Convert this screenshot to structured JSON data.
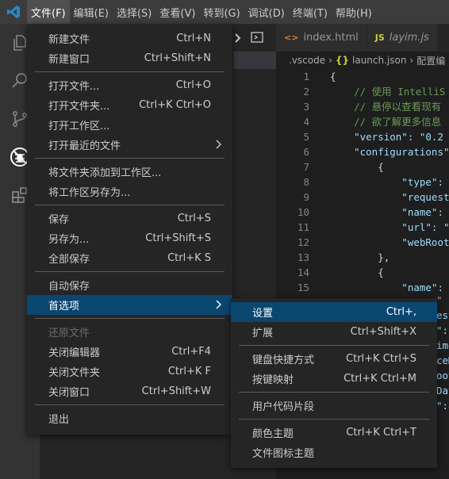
{
  "menubar": {
    "items": [
      "文件(F)",
      "编辑(E)",
      "选择(S)",
      "查看(V)",
      "转到(G)",
      "调试(D)",
      "终端(T)",
      "帮助(H)"
    ]
  },
  "tabs": [
    {
      "icon": "<>",
      "label": "index.html"
    },
    {
      "icon": "JS",
      "label": "layim.js"
    }
  ],
  "breadcrumb": {
    "folder": ".vscode",
    "file_icon": "{}",
    "file": "launch.json",
    "symbol": "配置编"
  },
  "code_lines": [
    {
      "n": "1",
      "text": "{"
    },
    {
      "n": "2",
      "text": "    // 使用 IntelliS"
    },
    {
      "n": "3",
      "text": "    // 悬停以查看现有"
    },
    {
      "n": "4",
      "text": "    // 欲了解更多信息"
    },
    {
      "n": "5",
      "text": "    \"version\": \"0.2"
    },
    {
      "n": "6",
      "text": "    \"configurations\""
    },
    {
      "n": "7",
      "text": "        {"
    },
    {
      "n": "8",
      "text": "            \"type\":"
    },
    {
      "n": "9",
      "text": "            \"request"
    },
    {
      "n": "10",
      "text": "            \"name\":"
    },
    {
      "n": "11",
      "text": "            \"url\": \""
    },
    {
      "n": "12",
      "text": "            \"webRoot"
    },
    {
      "n": "13",
      "text": "        },"
    },
    {
      "n": "14",
      "text": "        {"
    },
    {
      "n": "15",
      "text": "            \"name\":"
    }
  ],
  "code_fragments": [
    "\"",
    "est",
    "\":",
    "ime",
    "ceM",
    "oot",
    "Dat",
    "\":8"
  ],
  "file_menu": {
    "groups": [
      [
        {
          "label": "新建文件",
          "shortcut": "Ctrl+N"
        },
        {
          "label": "新建窗口",
          "shortcut": "Ctrl+Shift+N"
        }
      ],
      [
        {
          "label": "打开文件...",
          "shortcut": "Ctrl+O"
        },
        {
          "label": "打开文件夹...",
          "shortcut": "Ctrl+K Ctrl+O"
        },
        {
          "label": "打开工作区...",
          "shortcut": ""
        },
        {
          "label": "打开最近的文件",
          "shortcut": "",
          "submenu": true
        }
      ],
      [
        {
          "label": "将文件夹添加到工作区...",
          "shortcut": ""
        },
        {
          "label": "将工作区另存为...",
          "shortcut": ""
        }
      ],
      [
        {
          "label": "保存",
          "shortcut": "Ctrl+S"
        },
        {
          "label": "另存为...",
          "shortcut": "Ctrl+Shift+S"
        },
        {
          "label": "全部保存",
          "shortcut": "Ctrl+K S"
        }
      ],
      [
        {
          "label": "自动保存",
          "shortcut": ""
        },
        {
          "label": "首选项",
          "shortcut": "",
          "submenu": true,
          "highlighted": true
        }
      ],
      [
        {
          "label": "还原文件",
          "shortcut": "",
          "disabled": true
        },
        {
          "label": "关闭编辑器",
          "shortcut": "Ctrl+F4"
        },
        {
          "label": "关闭文件夹",
          "shortcut": "Ctrl+K F"
        },
        {
          "label": "关闭窗口",
          "shortcut": "Ctrl+Shift+W"
        }
      ],
      [
        {
          "label": "退出",
          "shortcut": ""
        }
      ]
    ]
  },
  "preferences_menu": {
    "groups": [
      [
        {
          "label": "设置",
          "shortcut": "Ctrl+,",
          "highlighted": true
        },
        {
          "label": "扩展",
          "shortcut": "Ctrl+Shift+X"
        }
      ],
      [
        {
          "label": "键盘快捷方式",
          "shortcut": "Ctrl+K Ctrl+S"
        },
        {
          "label": "按键映射",
          "shortcut": "Ctrl+K Ctrl+M"
        }
      ],
      [
        {
          "label": "用户代码片段",
          "shortcut": ""
        }
      ],
      [
        {
          "label": "颜色主题",
          "shortcut": "Ctrl+K Ctrl+T"
        },
        {
          "label": "文件图标主题",
          "shortcut": ""
        }
      ]
    ]
  },
  "icons": {
    "app": "vscode-logo-icon",
    "activity": [
      "files-icon",
      "search-icon",
      "source-control-icon",
      "debug-icon",
      "extensions-icon"
    ],
    "sidebar": [
      "ellipsis-icon",
      "panel-icon"
    ]
  },
  "colors": {
    "accent": "#094771",
    "menu_background": "#252526",
    "menubar_background": "#3c3c3c",
    "activitybar": "#333333",
    "editor_background": "#1e1e1e",
    "logo_blue": "#2489ca"
  }
}
